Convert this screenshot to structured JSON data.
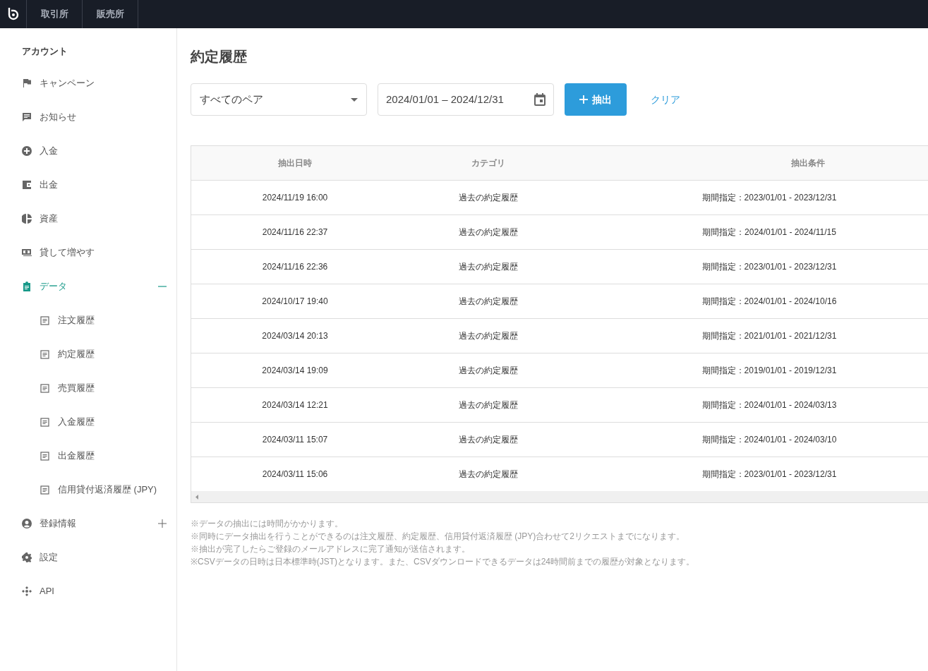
{
  "topbar": {
    "tabs": [
      {
        "label": "取引所"
      },
      {
        "label": "販売所"
      }
    ]
  },
  "sidebar": {
    "heading": "アカウント",
    "items": [
      {
        "kind": "link",
        "label": "キャンペーン",
        "active": false
      },
      {
        "kind": "link",
        "label": "お知らせ",
        "active": false
      },
      {
        "kind": "link",
        "label": "入金",
        "active": false
      },
      {
        "kind": "link",
        "label": "出金",
        "active": false
      },
      {
        "kind": "link",
        "label": "資産",
        "active": false
      },
      {
        "kind": "link",
        "label": "貸して増やす",
        "active": false
      },
      {
        "kind": "group",
        "label": "データ",
        "active": true,
        "expanded": true,
        "children": [
          {
            "label": "注文履歴"
          },
          {
            "label": "約定履歴"
          },
          {
            "label": "売買履歴"
          },
          {
            "label": "入金履歴"
          },
          {
            "label": "出金履歴"
          },
          {
            "label": "信用貸付返済履歴 (JPY)"
          }
        ]
      },
      {
        "kind": "group",
        "label": "登録情報",
        "active": false,
        "expanded": false
      },
      {
        "kind": "link",
        "label": "設定",
        "active": false
      },
      {
        "kind": "link",
        "label": "API",
        "active": false
      }
    ]
  },
  "page_title": "約定履歴",
  "filters": {
    "pair_select": "すべてのペア",
    "date_range": "2024/01/01 – 2024/12/31",
    "extract_button": "抽出",
    "clear_link": "クリア"
  },
  "table": {
    "columns": [
      "抽出日時",
      "カテゴリ",
      "抽出条件"
    ],
    "rows": [
      [
        "2024/11/19 16:00",
        "過去の約定履歴",
        "期間指定：2023/01/01 - 2023/12/31"
      ],
      [
        "2024/11/16 22:37",
        "過去の約定履歴",
        "期間指定：2024/01/01 - 2024/11/15"
      ],
      [
        "2024/11/16 22:36",
        "過去の約定履歴",
        "期間指定：2023/01/01 - 2023/12/31"
      ],
      [
        "2024/10/17 19:40",
        "過去の約定履歴",
        "期間指定：2024/01/01 - 2024/10/16"
      ],
      [
        "2024/03/14 20:13",
        "過去の約定履歴",
        "期間指定：2021/01/01 - 2021/12/31"
      ],
      [
        "2024/03/14 19:09",
        "過去の約定履歴",
        "期間指定：2019/01/01 - 2019/12/31"
      ],
      [
        "2024/03/14 12:21",
        "過去の約定履歴",
        "期間指定：2024/01/01 - 2024/03/13"
      ],
      [
        "2024/03/11 15:07",
        "過去の約定履歴",
        "期間指定：2024/01/01 - 2024/03/10"
      ],
      [
        "2024/03/11 15:06",
        "過去の約定履歴",
        "期間指定：2023/01/01 - 2023/12/31"
      ]
    ]
  },
  "notes": [
    "※データの抽出には時間がかかります。",
    "※同時にデータ抽出を行うことができるのは注文履歴、約定履歴、信用貸付返済履歴 (JPY)合わせて2リクエストまでになります。",
    "※抽出が完了したらご登録のメールアドレスに完了通知が送信されます。",
    "※CSVデータの日時は日本標準時(JST)となります。また、CSVダウンロードできるデータは24時間前までの履歴が対象となります。"
  ]
}
